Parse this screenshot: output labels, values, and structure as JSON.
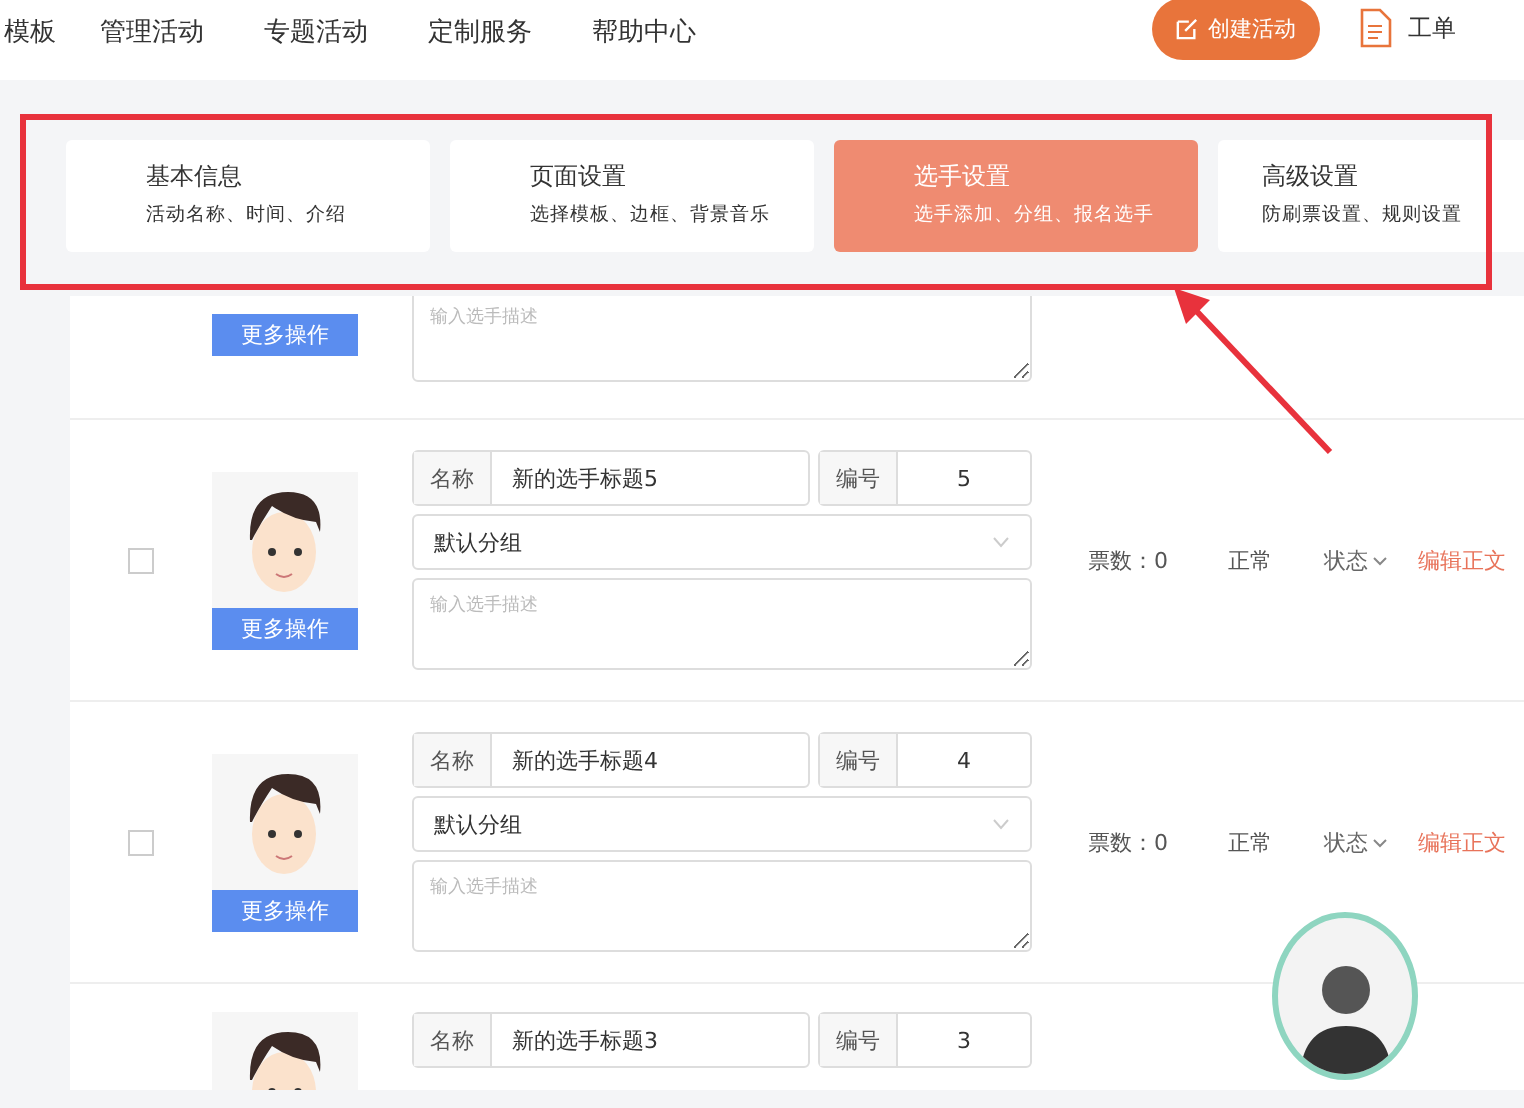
{
  "nav": {
    "items": [
      "模板",
      "管理活动",
      "专题活动",
      "定制服务",
      "帮助中心"
    ],
    "create_button": "创建活动",
    "ticket_link": "工单"
  },
  "steps": [
    {
      "title": "基本信息",
      "subtitle": "活动名称、时间、介绍",
      "selected": false
    },
    {
      "title": "页面设置",
      "subtitle": "选择模板、边框、背景音乐",
      "selected": false
    },
    {
      "title": "选手设置",
      "subtitle": "选手添加、分组、报名选手",
      "selected": true
    },
    {
      "title": "高级设置",
      "subtitle": "防刷票设置、规则设置",
      "selected": false
    }
  ],
  "players": [
    {
      "kind": "partial_top",
      "description_placeholder": "输入选手描述",
      "more_button": "更多操作"
    },
    {
      "kind": "full",
      "checked": false,
      "name_label": "名称",
      "name": "新的选手标题5",
      "number_label": "编号",
      "number": "5",
      "group": "默认分组",
      "description_placeholder": "输入选手描述",
      "more_button": "更多操作",
      "votes": "票数：0",
      "status": "正常",
      "state_menu": "状态",
      "edit_link": "编辑正文"
    },
    {
      "kind": "full",
      "checked": false,
      "name_label": "名称",
      "name": "新的选手标题4",
      "number_label": "编号",
      "number": "4",
      "group": "默认分组",
      "description_placeholder": "输入选手描述",
      "more_button": "更多操作",
      "votes": "票数：0",
      "status": "正常",
      "state_menu": "状态",
      "edit_link": "编辑正文"
    },
    {
      "kind": "partial_bottom",
      "name_label": "名称",
      "name": "新的选手标题3",
      "number_label": "编号",
      "number": "3"
    }
  ]
}
